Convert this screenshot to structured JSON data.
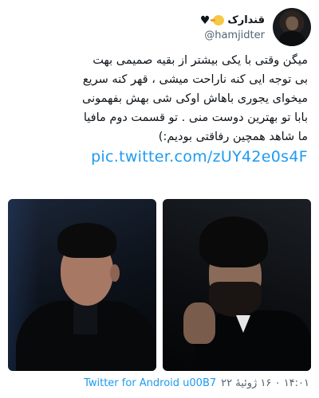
{
  "user": {
    "display_name": "قندارک",
    "handle": "@hamjidter",
    "icons": [
      "hatching-chick-emoji",
      "black-heart-emoji"
    ]
  },
  "tweet": {
    "lines": [
      "میگن وقتی با یکی بیشتر از بقیه صمیمی بهت",
      "بی توجه ایی کنه ناراحت میشی ، قهر کنه سریع",
      "میخوای یجوری باهاش اوکی شی بهش بفهمونی",
      "بابا تو بهترین دوست منی . تو قسمت دوم مافیا",
      "ما شاهد همچین رفاقتی بودیم:)"
    ],
    "link": "pic.twitter.com/zUY42e0s4F"
  },
  "media": {
    "photos": [
      "man-in-dark-suit",
      "man-with-beard-hand-on-chin"
    ]
  },
  "footer": {
    "timestamp": "۱۴:۰۱ ۰ ۱۶ ژوئیهٔ ۲۲",
    "source": "Twitter for Android u00B7"
  },
  "colors": {
    "link": "#1d9bf0",
    "text": "#0f1419",
    "secondary": "#536471"
  }
}
